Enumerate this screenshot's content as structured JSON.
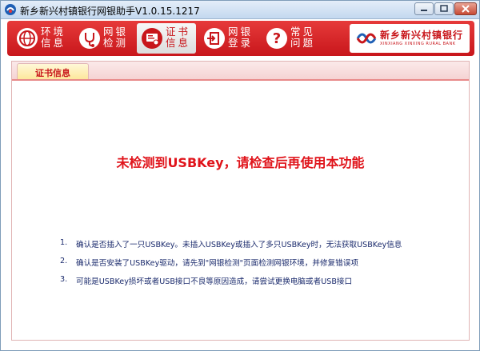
{
  "window": {
    "title": "新乡新兴村镇银行网银助手V1.0.15.1217"
  },
  "nav": {
    "items": [
      {
        "id": "env",
        "label_line1": "环境",
        "label_line2": "信息",
        "icon": "globe-icon"
      },
      {
        "id": "check",
        "label_line1": "网银",
        "label_line2": "检测",
        "icon": "stethoscope-icon"
      },
      {
        "id": "cert",
        "label_line1": "证书",
        "label_line2": "信息",
        "icon": "certificate-icon",
        "active": true
      },
      {
        "id": "login",
        "label_line1": "网银",
        "label_line2": "登录",
        "icon": "login-door-icon"
      },
      {
        "id": "faq",
        "label_line1": "常见",
        "label_line2": "问题",
        "icon": "question-icon"
      }
    ]
  },
  "bank": {
    "name": "新乡新兴村镇银行",
    "subtitle": "XINXIANG XINXING RURAL BANK"
  },
  "tabs": {
    "active_label": "证书信息"
  },
  "main": {
    "headline": "未检测到USBKey，请检查后再使用本功能",
    "steps": [
      {
        "num": "1.",
        "text": "确认是否插入了一只USBKey。未插入USBKey或插入了多只USBKey时，无法获取USBKey信息"
      },
      {
        "num": "2.",
        "text": "确认是否安装了USBKey驱动，请先到\"网银检测\"页面检测网银环境，并修复错误项"
      },
      {
        "num": "3.",
        "text": "可能是USBKey损坏或者USB接口不良等原因造成，请尝试更换电脑或者USB接口"
      }
    ]
  },
  "colors": {
    "brand_red": "#c8161b",
    "headline_red": "#e0141b",
    "step_text": "#1a2a6c"
  }
}
